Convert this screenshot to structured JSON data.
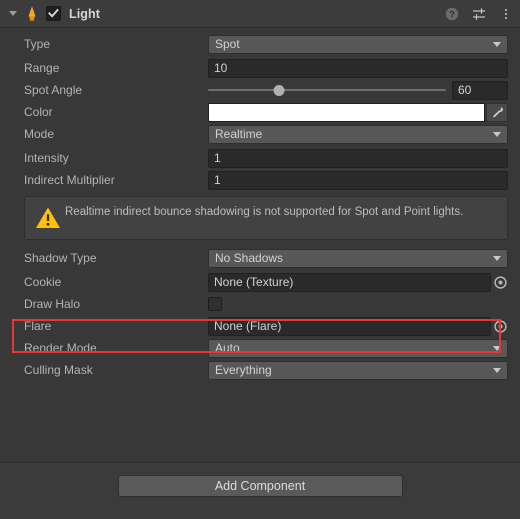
{
  "header": {
    "title": "Light",
    "foldout_icon": "triangle-down-icon",
    "component_icon": "light-bulb-icon",
    "enabled": true,
    "enabled_checkbox_icon": "checkmark-icon",
    "help_icon": "help-question-icon",
    "preset_icon": "preset-sliders-icon",
    "menu_icon": "vertical-three-dots-icon"
  },
  "fields": {
    "type": {
      "label": "Type",
      "value": "Spot",
      "control": "dropdown"
    },
    "range": {
      "label": "Range",
      "value": "10",
      "control": "textinput"
    },
    "spot_angle": {
      "label": "Spot Angle",
      "value": "60",
      "control": "slider",
      "slider_percent": 30
    },
    "color": {
      "label": "Color",
      "value_hex": "#FFFFFF",
      "control": "colorswatch",
      "eyedropper_icon": "eyedropper-icon"
    },
    "mode": {
      "label": "Mode",
      "value": "Realtime",
      "control": "dropdown"
    },
    "intensity": {
      "label": "Intensity",
      "value": "1",
      "control": "textinput"
    },
    "indirect_multiplier": {
      "label": "Indirect Multiplier",
      "value": "1",
      "control": "textinput"
    },
    "shadow_type": {
      "label": "Shadow Type",
      "value": "No Shadows",
      "control": "dropdown"
    },
    "cookie": {
      "label": "Cookie",
      "value": "None (Texture)",
      "control": "objectfield",
      "picker_icon": "object-picker-icon"
    },
    "draw_halo": {
      "label": "Draw Halo",
      "checked": false,
      "control": "checkbox"
    },
    "flare": {
      "label": "Flare",
      "value": "None (Flare)",
      "control": "objectfield",
      "picker_icon": "object-picker-icon"
    },
    "render_mode": {
      "label": "Render Mode",
      "value": "Auto",
      "control": "dropdown"
    },
    "culling_mask": {
      "label": "Culling Mask",
      "value": "Everything",
      "control": "dropdown"
    }
  },
  "warning": {
    "icon": "warning-triangle-icon",
    "text": "Realtime indirect bounce shadowing is not supported for Spot and Point lights."
  },
  "footer": {
    "add_component_label": "Add Component"
  },
  "annotation": {
    "type": "highlight-rectangle",
    "target": "Cookie",
    "color": "#E8353A"
  },
  "colors": {
    "panel_bg": "#383838",
    "header_bg": "#3C3C3C",
    "dropdown_bg": "#585858",
    "input_bg": "#2A2A2A",
    "label_text": "#B4B4B4",
    "value_text": "#D2D2D2",
    "warning_amber": "#FFC107",
    "bulb_amber": "#F5A623"
  }
}
